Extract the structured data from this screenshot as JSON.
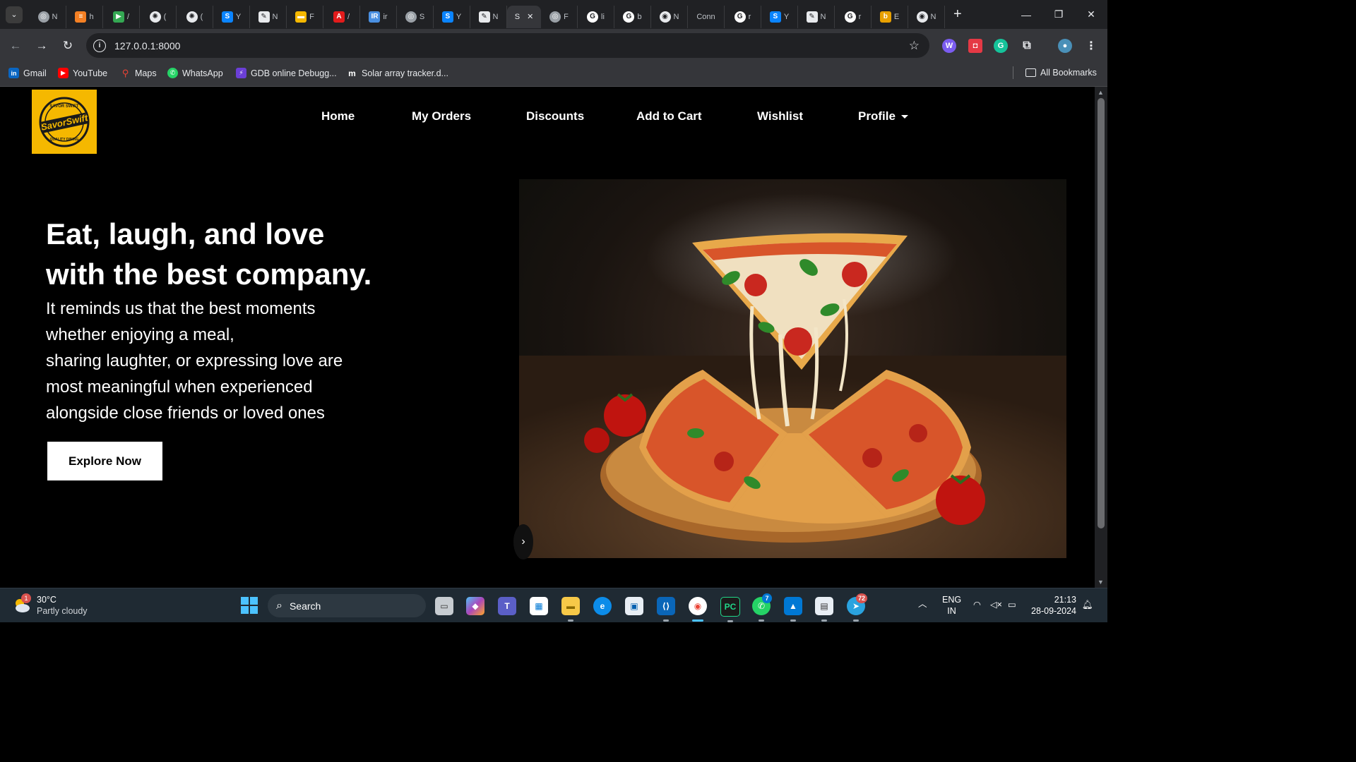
{
  "browser": {
    "tabs": [
      {
        "icon": "globe-icon",
        "title": "N"
      },
      {
        "icon": "stackoverflow-icon",
        "title": "h"
      },
      {
        "icon": "play-icon",
        "title": "/"
      },
      {
        "icon": "openai-icon",
        "title": "("
      },
      {
        "icon": "openai-icon",
        "title": "("
      },
      {
        "icon": "s-icon",
        "title": "Y"
      },
      {
        "icon": "quill-icon",
        "title": "N"
      },
      {
        "icon": "folder-icon",
        "title": "F"
      },
      {
        "icon": "adobe-icon",
        "title": "/"
      },
      {
        "icon": "ir-icon",
        "title": "ir"
      },
      {
        "icon": "globe-icon",
        "title": "S"
      },
      {
        "icon": "s-icon",
        "title": "Y"
      },
      {
        "icon": "quill-icon",
        "title": "N"
      },
      {
        "icon": "none",
        "title": "S",
        "active": true
      },
      {
        "icon": "globe-icon",
        "title": "F"
      },
      {
        "icon": "google-icon",
        "title": "li"
      },
      {
        "icon": "google-icon",
        "title": "b"
      },
      {
        "icon": "github-icon",
        "title": "N"
      },
      {
        "icon": "none",
        "title": "Conn"
      },
      {
        "icon": "google-icon",
        "title": "r"
      },
      {
        "icon": "s-icon",
        "title": "Y"
      },
      {
        "icon": "quill-icon",
        "title": "N"
      },
      {
        "icon": "google-icon",
        "title": "r"
      },
      {
        "icon": "bb-icon",
        "title": "E"
      },
      {
        "icon": "github-icon",
        "title": "N"
      }
    ],
    "url": "127.0.0.1:8000",
    "bookmarks": [
      {
        "icon": "linkedin-icon",
        "label": "Gmail"
      },
      {
        "icon": "youtube-icon",
        "label": "YouTube"
      },
      {
        "icon": "maps-icon",
        "label": "Maps"
      },
      {
        "icon": "whatsapp-icon",
        "label": "WhatsApp"
      },
      {
        "icon": "gdb-icon",
        "label": "GDB online Debugg..."
      },
      {
        "icon": "tm-icon",
        "label": "Solar array tracker.d..."
      }
    ],
    "all_bookmarks": "All Bookmarks"
  },
  "site": {
    "logo_text": "SavorSwift",
    "logo_top": "SAVOR SWIFT",
    "logo_bottom": "QUALITY DINING",
    "nav": [
      "Home",
      "My Orders",
      "Discounts",
      "Add to Cart",
      "Wishlist",
      "Profile"
    ],
    "headline": "Eat, laugh, and love with the best company.",
    "subtext_lines": [
      "It reminds us that the best moments",
      "whether enjoying a meal,",
      "sharing laughter, or expressing love are",
      "most meaningful when experienced",
      "alongside close friends or loved ones"
    ],
    "cta": "Explore Now",
    "hero_image": "pizza-photo"
  },
  "taskbar": {
    "weather_temp": "30°C",
    "weather_cond": "Partly cloudy",
    "weather_badge": "1",
    "search": "Search",
    "whatsapp_badge": "7",
    "telegram_badge": "72",
    "lang_top": "ENG",
    "lang_bottom": "IN",
    "time": "21:13",
    "date": "28-09-2024"
  },
  "colors": {
    "accent_logo": "#f5b800",
    "page_bg": "#000000",
    "chrome_bg": "#35363a"
  }
}
